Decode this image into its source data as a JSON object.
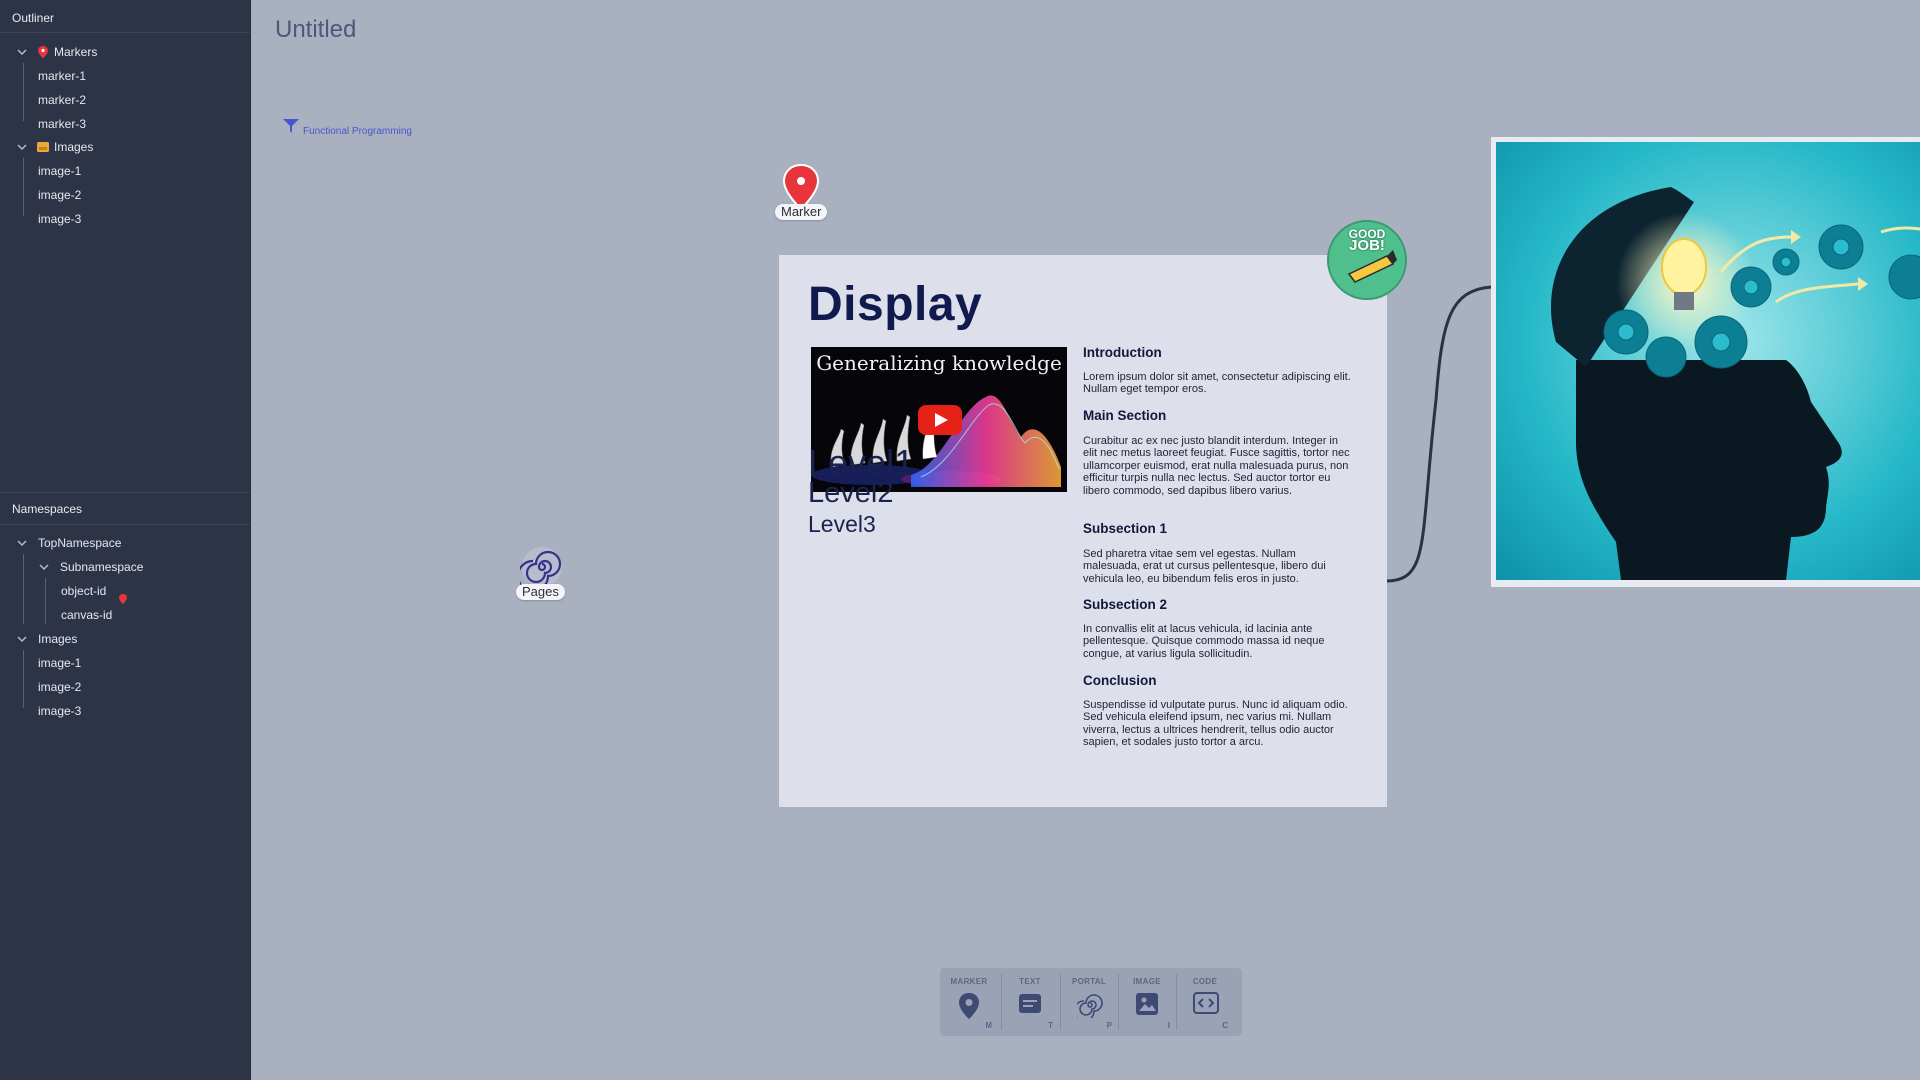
{
  "outliner": {
    "title": "Outliner",
    "markers_label": "Markers",
    "markers": [
      "marker-1",
      "marker-2",
      "marker-3"
    ],
    "images_label": "Images",
    "images": [
      "image-1",
      "image-2",
      "image-3"
    ]
  },
  "namespaces": {
    "title": "Namespaces",
    "top_label": "TopNamespace",
    "sub_label": "Subnamespace",
    "sub_items": [
      "object-id",
      "canvas-id"
    ],
    "images_label": "Images",
    "images": [
      "image-1",
      "image-2",
      "image-3"
    ]
  },
  "canvas": {
    "title": "Untitled",
    "filter_label": "Functional Programming",
    "marker_label": "Marker",
    "pages_label": "Pages"
  },
  "display": {
    "title": "Display",
    "video_caption": "Generalizing knowledge",
    "levels": [
      "Level1",
      "Level2",
      "Level3"
    ],
    "sections": [
      {
        "heading": "Introduction",
        "text": "Lorem ipsum dolor sit amet, consectetur adipiscing elit. Nullam eget tempor eros."
      },
      {
        "heading": "Main Section",
        "text": "Curabitur ac ex nec justo blandit interdum. Integer in elit nec metus laoreet feugiat. Fusce sagittis, tortor nec ullamcorper euismod, erat nulla malesuada purus, non efficitur turpis nulla nec lectus. Sed auctor tortor eu libero commodo, sed dapibus libero varius."
      },
      {
        "heading": "Subsection 1",
        "text": "Sed pharetra vitae sem vel egestas. Nullam malesuada, erat ut cursus pellentesque, libero dui vehicula leo, eu bibendum felis eros in justo."
      },
      {
        "heading": "Subsection 2",
        "text": "In convallis elit at lacus vehicula, id lacinia ante pellentesque. Quisque commodo massa id neque congue, at varius ligula sollicitudin."
      },
      {
        "heading": "Conclusion",
        "text": "Suspendisse id vulputate purus. Nunc id aliquam odio. Sed vehicula eleifend ipsum, nec varius mi. Nullam viverra, lectus a ultrices hendrerit, tellus odio auctor sapien, et sodales justo tortor a arcu."
      }
    ]
  },
  "sticker": {
    "line1": "GOOD",
    "line2": "JOB!"
  },
  "toolbar": {
    "tools": [
      {
        "label": "MARKER",
        "key": "M",
        "icon": "marker-pin-icon"
      },
      {
        "label": "TEXT",
        "key": "T",
        "icon": "text-icon"
      },
      {
        "label": "PORTAL",
        "key": "P",
        "icon": "portal-spiral-icon"
      },
      {
        "label": "IMAGE",
        "key": "I",
        "icon": "image-icon"
      },
      {
        "label": "CODE",
        "key": "C",
        "icon": "code-icon"
      }
    ]
  },
  "colors": {
    "canvas_bg": "#a9b1c1",
    "sidebar_bg": "#2e3447",
    "marker_red": "#e8353b",
    "card_bg": "#dde0ea",
    "heading_navy": "#111a4e",
    "accent_blue": "#4a55c8"
  }
}
